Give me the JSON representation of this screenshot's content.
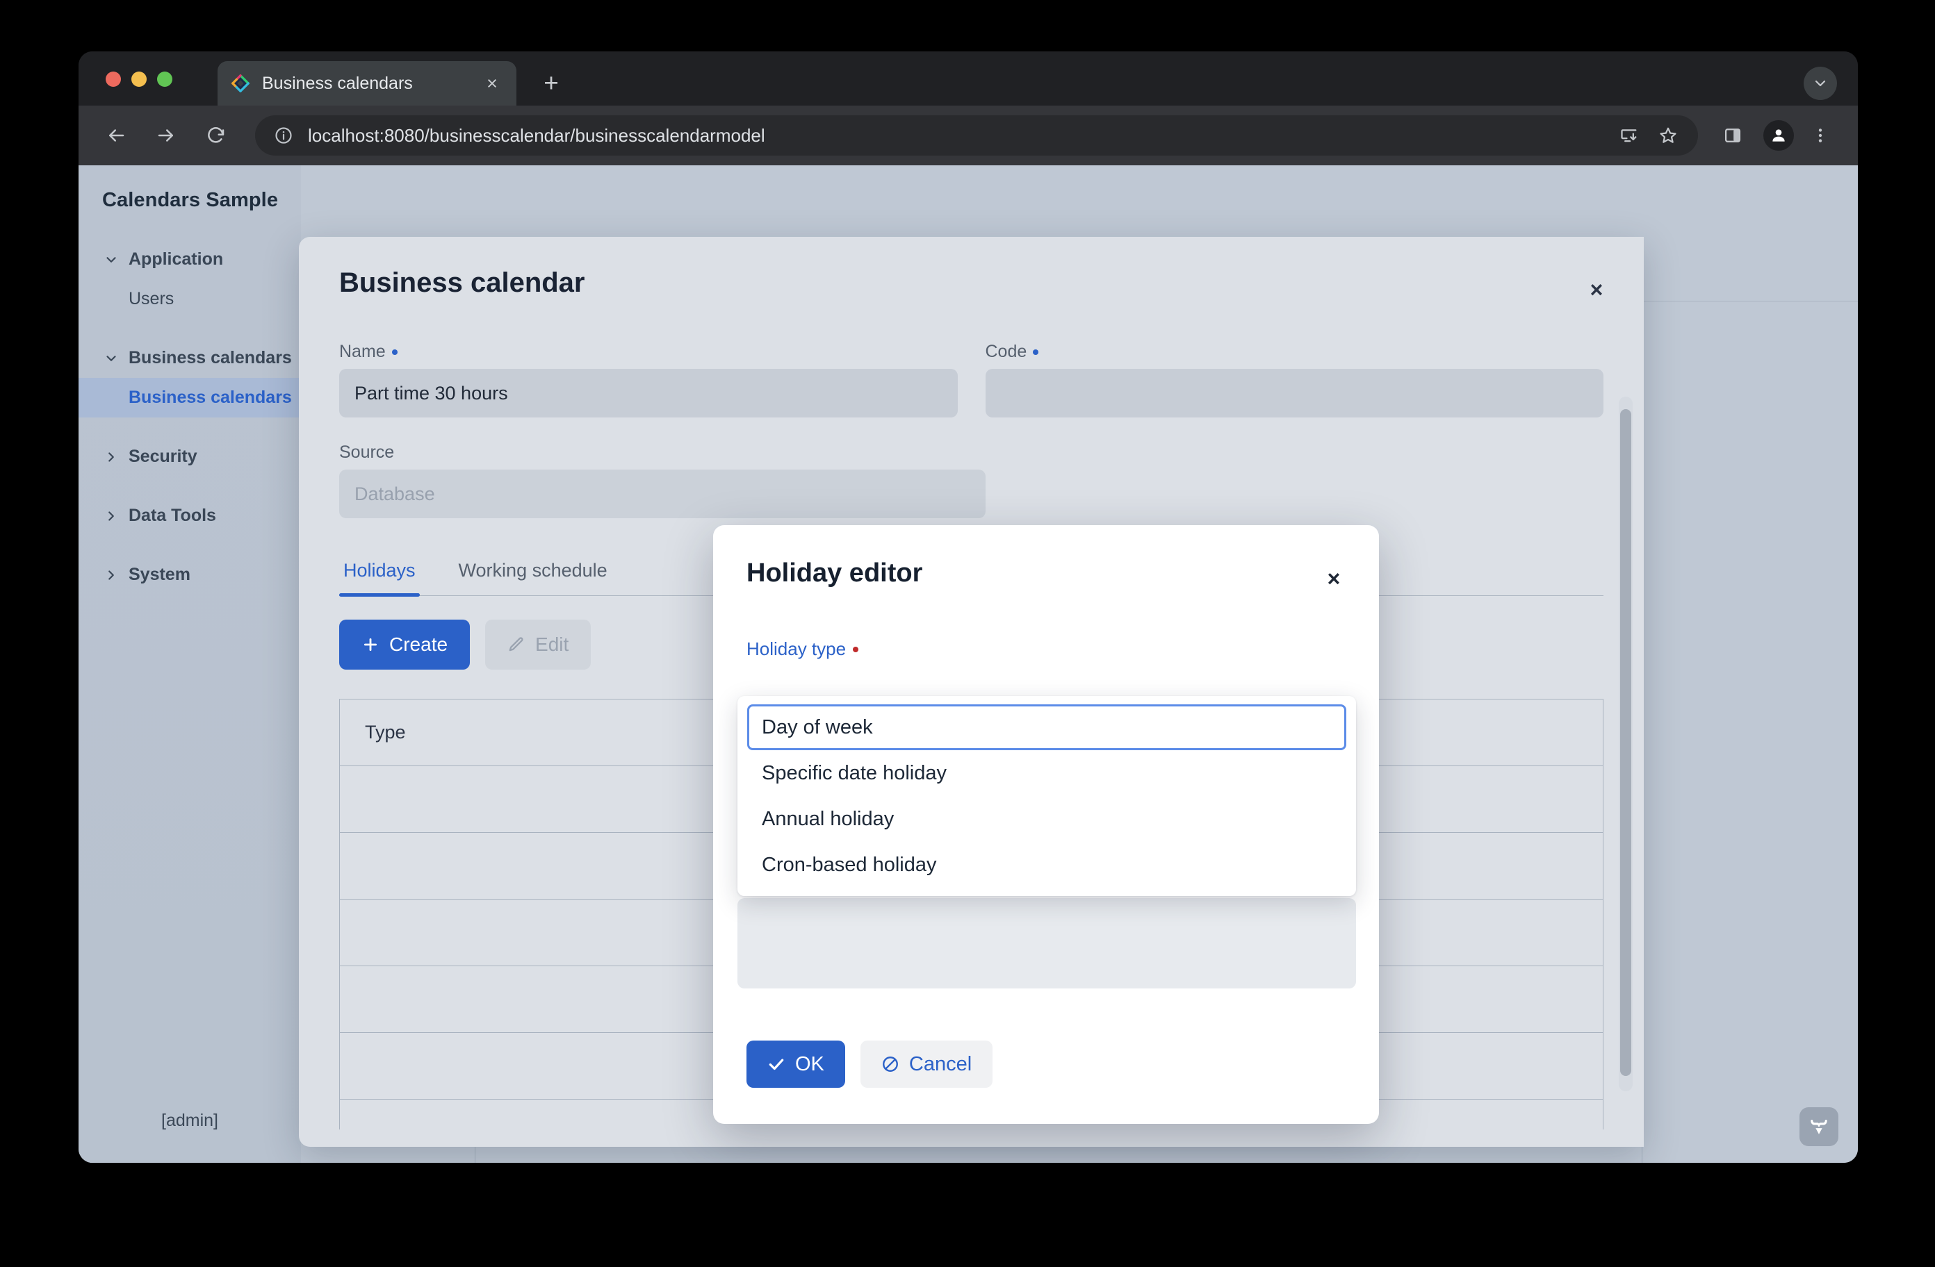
{
  "browser": {
    "tab": {
      "title": "Business calendars",
      "favicon_name": "app-favicon",
      "close_label": "×"
    },
    "new_tab_label": "+",
    "toolbar": {
      "back_name": "back-button",
      "forward_name": "forward-button",
      "reload_name": "reload-button",
      "url": "localhost:8080/businesscalendar/businesscalendarmodel",
      "site_info_name": "site-info-icon",
      "install_name": "install-app-icon",
      "bookmark_name": "bookmark-star-icon",
      "side_panel_name": "side-panel-icon",
      "profile_name": "profile-avatar",
      "menu_name": "browser-menu-icon"
    }
  },
  "sidebar": {
    "app_title": "Calendars Sample",
    "items": [
      {
        "label": "Application",
        "type": "group",
        "expanded": true
      },
      {
        "label": "Users",
        "type": "item",
        "selected": false
      },
      {
        "label": "Business calendars",
        "type": "group",
        "expanded": true
      },
      {
        "label": "Business calendars",
        "type": "item",
        "selected": true
      },
      {
        "label": "Security",
        "type": "group",
        "expanded": false
      },
      {
        "label": "Data Tools",
        "type": "group",
        "expanded": false
      },
      {
        "label": "System",
        "type": "group",
        "expanded": false
      }
    ],
    "user": "[admin]"
  },
  "business_calendar_dialog": {
    "title": "Business calendar",
    "close_label": "×",
    "fields": {
      "name_label": "Name",
      "name_value": "Part time 30 hours",
      "name_required": true,
      "code_label": "Code",
      "code_value": "",
      "code_required": true,
      "source_label": "Source",
      "source_value": "Database",
      "source_required": false
    },
    "tabs": [
      {
        "label": "Holidays",
        "active": true
      },
      {
        "label": "Working schedule",
        "active": false
      }
    ],
    "actions": {
      "create_label": "Create",
      "create_icon": "plus-icon",
      "edit_label": "Edit",
      "edit_icon": "pencil-icon",
      "edit_disabled": true
    },
    "grid": {
      "columns": [
        "Type"
      ],
      "rows": []
    }
  },
  "holiday_editor": {
    "title": "Holiday editor",
    "close_label": "×",
    "field_label": "Holiday type",
    "field_required": true,
    "options": [
      {
        "label": "Day of week",
        "focused": true
      },
      {
        "label": "Specific date holiday",
        "focused": false
      },
      {
        "label": "Annual holiday",
        "focused": false
      },
      {
        "label": "Cron-based holiday",
        "focused": false
      }
    ],
    "buttons": {
      "ok_label": "OK",
      "ok_icon": "check-icon",
      "cancel_label": "Cancel",
      "cancel_icon": "ban-icon"
    }
  },
  "footer_badge": {
    "name": "vaadin-logo-icon"
  },
  "colors": {
    "accent": "#2B61C8",
    "focus_ring": "#5C8CE8",
    "required_blue": "#2B61C8",
    "required_red": "#C02B2B",
    "dialog_bg": "#DCE0E6",
    "page_bg": "#BFC8D4",
    "sidebar_selected": "#A9BAD6",
    "browser_chrome": "#202124"
  }
}
